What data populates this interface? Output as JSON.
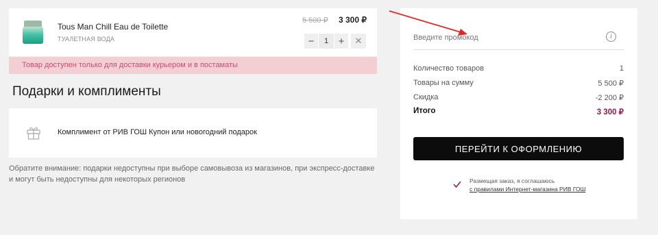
{
  "product": {
    "name": "Tous Man Chill Eau de Toilette",
    "type": "туалетная вода",
    "old_price": "5 500 ₽",
    "price": "3 300 ₽",
    "quantity": "1",
    "decrement_icon": "−",
    "increment_icon": "+",
    "remove_icon": "✕"
  },
  "delivery_notice": "Товар доступен только для доставки курьером и в постаматы",
  "gifts": {
    "title": "Подарки и комплименты",
    "compliment_text": "Комплимент от РИВ ГОШ Купон или новогодний подарок"
  },
  "notice": "Обратите внимание: подарки недоступны при выборе самовывоза из магазинов, при экспресс-доставке и могут быть недоступны для некоторых регионов",
  "summary": {
    "promo_placeholder": "Введите промокод",
    "info_icon": "i",
    "rows": [
      {
        "label": "Количество товаров",
        "value": "1"
      },
      {
        "label": "Товары на сумму",
        "value": "5 500 ₽"
      },
      {
        "label": "Скидка",
        "value": "-2 200 ₽"
      }
    ],
    "total": {
      "label": "Итого",
      "value": "3 300 ₽"
    },
    "checkout_label": "Перейти к оформлению",
    "agree_text": "Размещая заказ, я соглашаюсь",
    "agree_link": "с правилами Интернет-магазина РИВ ГОШ"
  },
  "colors": {
    "accent": "#8c1b4e",
    "notice_bg": "#f3cfd4",
    "notice_text": "#c2506a",
    "arrow": "#e0282a"
  }
}
